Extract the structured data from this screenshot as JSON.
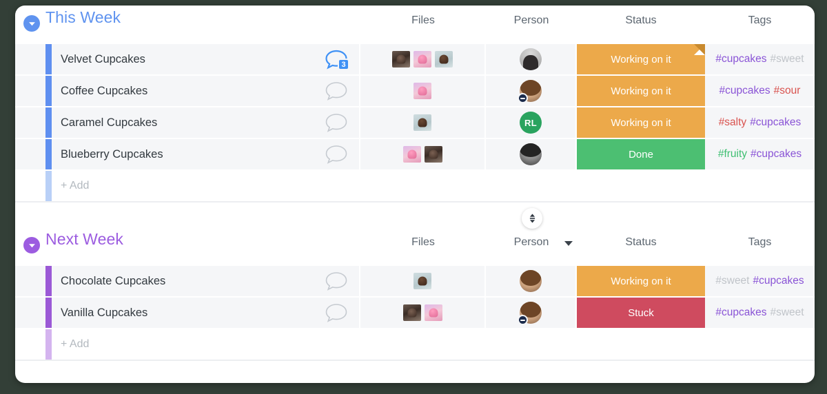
{
  "board": {
    "columns": [
      {
        "key": "files",
        "label": "Files"
      },
      {
        "key": "person",
        "label": "Person"
      },
      {
        "key": "status",
        "label": "Status"
      },
      {
        "key": "tags",
        "label": "Tags"
      }
    ],
    "add_row_label": "+ Add",
    "sort_control": {
      "name": "sort-toggle",
      "tooltip": "Sort"
    },
    "person_menu_caret": "▾"
  },
  "colors": {
    "group_this_week": "#5f93ef",
    "group_next_week": "#9c5ce0",
    "row_bar_this_week": "#5f8ff0",
    "row_bar_next_week": "#9b59d6",
    "row_bar_add_this_week": "#b9d0f7",
    "row_bar_add_next_week": "#d4b4ef",
    "status_working": "#eca94a",
    "status_working_fold": "#c98a2e",
    "status_done": "#4cbf72",
    "status_stuck": "#cf4b5f",
    "tag_cupcakes": "#8a54d6",
    "tag_sweet": "#c0c4c9",
    "tag_sour": "#d9534f",
    "tag_salty": "#d9534f",
    "tag_fruity": "#3fbf72",
    "avatar_initials_bg": "#2aa35f",
    "chat_active": "#3f91f5",
    "chat_idle": "#c5cad0",
    "card_bg": "#ffffff",
    "row_bg": "#f5f6f8",
    "backdrop": "#333f37"
  },
  "groups": [
    {
      "id": "this-week",
      "title": "This Week",
      "collapsed": false,
      "toggle_icon": "chevron-down-icon",
      "rows": [
        {
          "name": "Velvet Cupcakes",
          "chat": {
            "icon": "chat-bubble-icon",
            "active": true,
            "count": "3"
          },
          "files": [
            {
              "name": "chocolate-cupcake-photo",
              "style": "choc"
            },
            {
              "name": "pink-cupcake-photo",
              "style": "pink"
            },
            {
              "name": "blue-cupcake-photo",
              "style": "blue"
            }
          ],
          "person": {
            "type": "photo",
            "style": "av-a",
            "initials": "",
            "status_badge": ""
          },
          "status": {
            "label": "Working on it",
            "color_key": "status_working",
            "has_note_fold": true
          },
          "tags": [
            {
              "text": "#cupcakes",
              "color_key": "tag_cupcakes"
            },
            {
              "text": "#sweet",
              "color_key": "tag_sweet"
            }
          ]
        },
        {
          "name": "Coffee Cupcakes",
          "chat": {
            "icon": "chat-bubble-icon",
            "active": false,
            "count": ""
          },
          "files": [
            {
              "name": "pink-cupcake-photo",
              "style": "pink"
            }
          ],
          "person": {
            "type": "photo",
            "style": "av-b",
            "initials": "",
            "status_badge": "do-not-disturb"
          },
          "status": {
            "label": "Working on it",
            "color_key": "status_working",
            "has_note_fold": false
          },
          "tags": [
            {
              "text": "#cupcakes",
              "color_key": "tag_cupcakes"
            },
            {
              "text": "#sour",
              "color_key": "tag_sour"
            }
          ]
        },
        {
          "name": "Caramel Cupcakes",
          "chat": {
            "icon": "chat-bubble-icon",
            "active": false,
            "count": ""
          },
          "files": [
            {
              "name": "blue-cupcake-photo",
              "style": "blue"
            }
          ],
          "person": {
            "type": "initials",
            "style": "av-c",
            "initials": "RL",
            "status_badge": ""
          },
          "status": {
            "label": "Working on it",
            "color_key": "status_working",
            "has_note_fold": false
          },
          "tags": [
            {
              "text": "#salty",
              "color_key": "tag_salty"
            },
            {
              "text": "#cupcakes",
              "color_key": "tag_cupcakes"
            }
          ]
        },
        {
          "name": "Blueberry Cupcakes",
          "chat": {
            "icon": "chat-bubble-icon",
            "active": false,
            "count": ""
          },
          "files": [
            {
              "name": "pink-cupcake-photo",
              "style": "pink"
            },
            {
              "name": "chocolate-cupcake-photo",
              "style": "choc"
            }
          ],
          "person": {
            "type": "photo",
            "style": "av-d",
            "initials": "",
            "status_badge": ""
          },
          "status": {
            "label": "Done",
            "color_key": "status_done",
            "has_note_fold": false
          },
          "tags": [
            {
              "text": "#fruity",
              "color_key": "tag_fruity"
            },
            {
              "text": "#cupcakes",
              "color_key": "tag_cupcakes"
            }
          ]
        }
      ]
    },
    {
      "id": "next-week",
      "title": "Next Week",
      "collapsed": false,
      "toggle_icon": "chevron-down-icon",
      "rows": [
        {
          "name": "Chocolate Cupcakes",
          "chat": {
            "icon": "chat-bubble-icon",
            "active": false,
            "count": ""
          },
          "files": [
            {
              "name": "blue-cupcake-photo",
              "style": "blue"
            }
          ],
          "person": {
            "type": "photo",
            "style": "av-b",
            "initials": "",
            "status_badge": ""
          },
          "status": {
            "label": "Working on it",
            "color_key": "status_working",
            "has_note_fold": false
          },
          "tags": [
            {
              "text": "#sweet",
              "color_key": "tag_sweet"
            },
            {
              "text": "#cupcakes",
              "color_key": "tag_cupcakes"
            }
          ]
        },
        {
          "name": "Vanilla Cupcakes",
          "chat": {
            "icon": "chat-bubble-icon",
            "active": false,
            "count": ""
          },
          "files": [
            {
              "name": "chocolate-cupcake-photo",
              "style": "choc"
            },
            {
              "name": "pink-cupcake-photo",
              "style": "pink"
            }
          ],
          "person": {
            "type": "photo",
            "style": "av-b",
            "initials": "",
            "status_badge": "do-not-disturb"
          },
          "status": {
            "label": "Stuck",
            "color_key": "status_stuck",
            "has_note_fold": false
          },
          "tags": [
            {
              "text": "#cupcakes",
              "color_key": "tag_cupcakes"
            },
            {
              "text": "#sweet",
              "color_key": "tag_sweet"
            }
          ]
        }
      ]
    }
  ]
}
